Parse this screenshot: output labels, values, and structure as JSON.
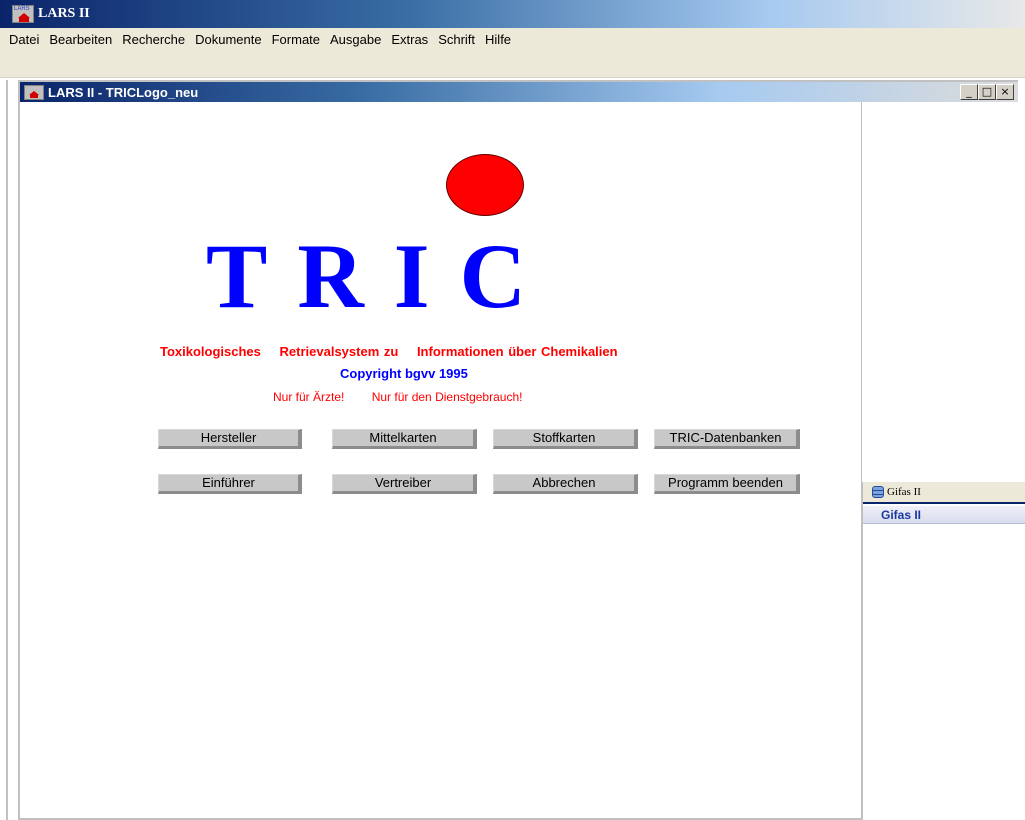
{
  "app": {
    "title": "LARS II",
    "icon_text": "LARS"
  },
  "menu": [
    "Datei",
    "Bearbeiten",
    "Recherche",
    "Dokumente",
    "Formate",
    "Ausgabe",
    "Extras",
    "Schrift",
    "Hilfe"
  ],
  "child_window": {
    "title": "LARS II - TRICLogo_neu",
    "controls": [
      "_",
      "□",
      "×"
    ]
  },
  "logo": {
    "text": "TRIC",
    "dot_color": "#ff0000",
    "text_color": "#0000ff"
  },
  "subtitle": {
    "parts": [
      "Toxikologisches",
      "Retrievalsystem zu",
      "Informationen über Chemikalien"
    ]
  },
  "copyright": "Copyright bgvv 1995",
  "notes": [
    "Nur für Ärzte!",
    "Nur für den Dienstgebrauch!"
  ],
  "buttons": {
    "hersteller": "Hersteller",
    "mittelkarten": "Mittelkarten",
    "stoffkarten": "Stoffkarten",
    "tric_datenbanken": "TRIC-Datenbanken",
    "einfuehrer": "Einführer",
    "vertreiber": "Vertreiber",
    "abbrechen": "Abbrechen",
    "programm_beenden": "Programm beenden"
  },
  "gifas": {
    "tab_label": "Gifas II",
    "header": "Gifas II"
  }
}
